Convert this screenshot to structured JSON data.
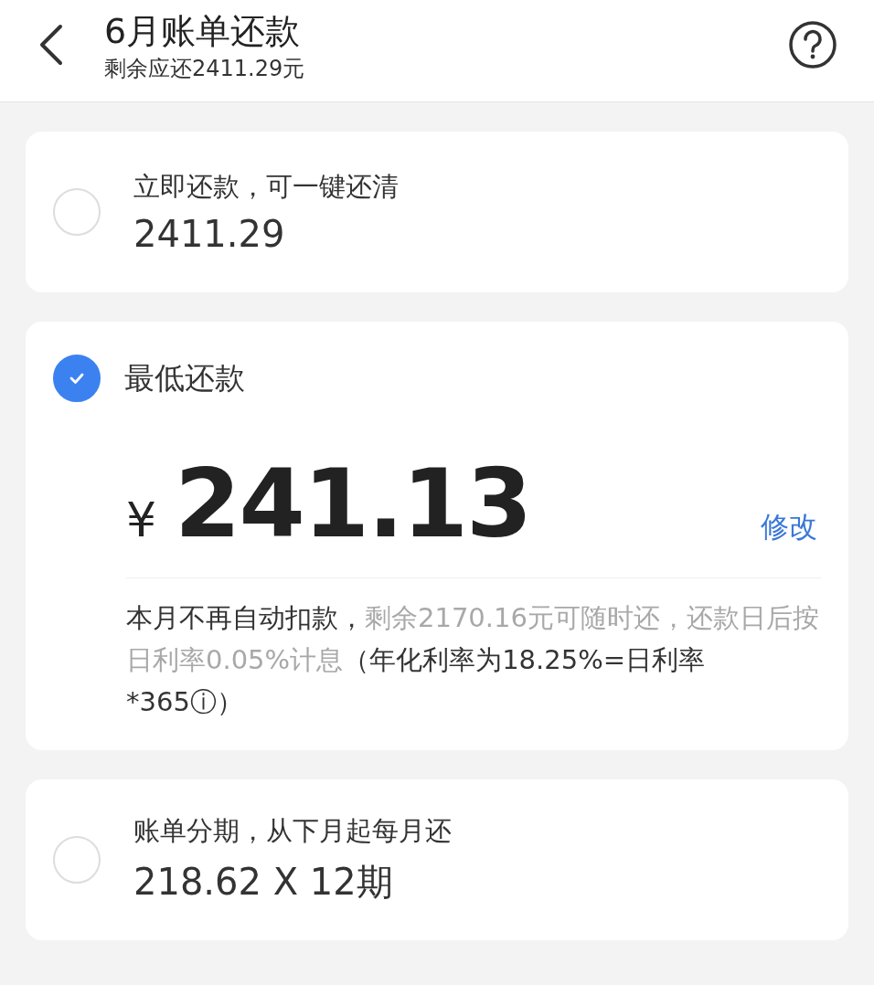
{
  "header": {
    "title": "6月账单还款",
    "subtitle": "剩余应还2411.29元"
  },
  "options": [
    {
      "kind": "simple",
      "selected": false,
      "label": "立即还款，可一键还清",
      "amount": "2411.29"
    },
    {
      "kind": "detailed",
      "selected": true,
      "label": "最低还款",
      "currency": "¥",
      "amount": "241.13",
      "edit": "修改",
      "note": [
        {
          "text": "本月不再自动扣款，",
          "muted": false
        },
        {
          "text": "剩余2170.16元可随时还，还款日后按日利率0.05%计息",
          "muted": true
        },
        {
          "text": "（年化利率为18.25%=日利率*365ⓘ）",
          "muted": false
        }
      ]
    },
    {
      "kind": "simple",
      "selected": false,
      "label": "账单分期，从下月起每月还",
      "amount": "218.62 X 12期"
    }
  ]
}
